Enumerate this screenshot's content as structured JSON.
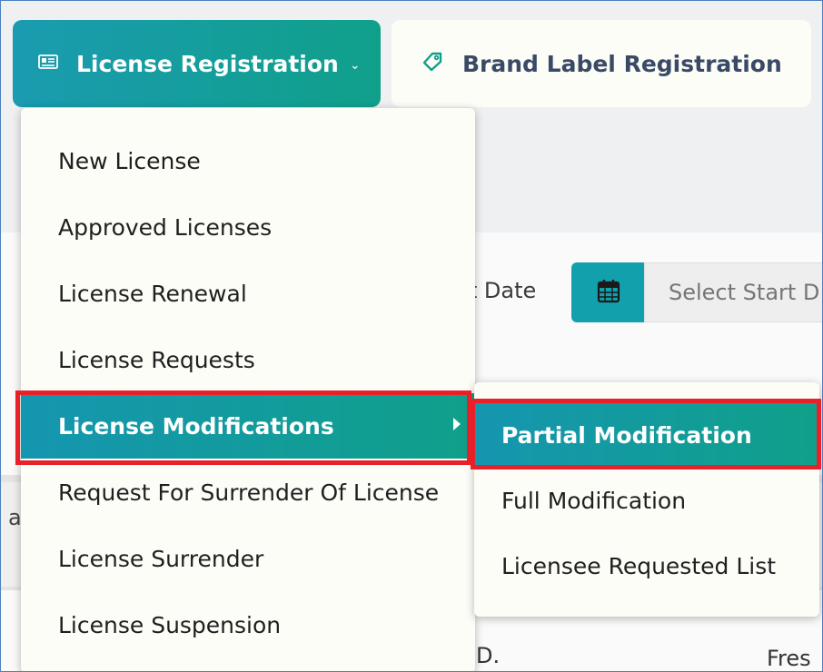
{
  "tabs": [
    {
      "label": "License Registration",
      "icon": "id-card-icon",
      "active": true,
      "has_dropdown": true
    },
    {
      "label": "Brand Label Registration",
      "icon": "tag-icon",
      "active": false
    }
  ],
  "filters": {
    "start_date_label": "rt Date",
    "start_date_placeholder": "Select Start D",
    "calendar_icon": "calendar-icon"
  },
  "background_fragments": {
    "side_letter": "a",
    "bottom_left": "D.",
    "bottom_right": "Fres"
  },
  "menu": {
    "items": [
      {
        "label": "New License"
      },
      {
        "label": "Approved Licenses"
      },
      {
        "label": "License Renewal"
      },
      {
        "label": "License Requests"
      },
      {
        "label": "License Modifications",
        "active": true,
        "has_submenu": true
      },
      {
        "label": "Request For Surrender Of License"
      },
      {
        "label": "License Surrender"
      },
      {
        "label": "License Suspension"
      }
    ]
  },
  "submenu": {
    "items": [
      {
        "label": "Partial Modification",
        "active": true
      },
      {
        "label": "Full Modification"
      },
      {
        "label": "Licensee Requested List"
      }
    ]
  },
  "colors": {
    "accent_start": "#1596b0",
    "accent_end": "#10a089",
    "highlight_border": "#e8202a"
  }
}
